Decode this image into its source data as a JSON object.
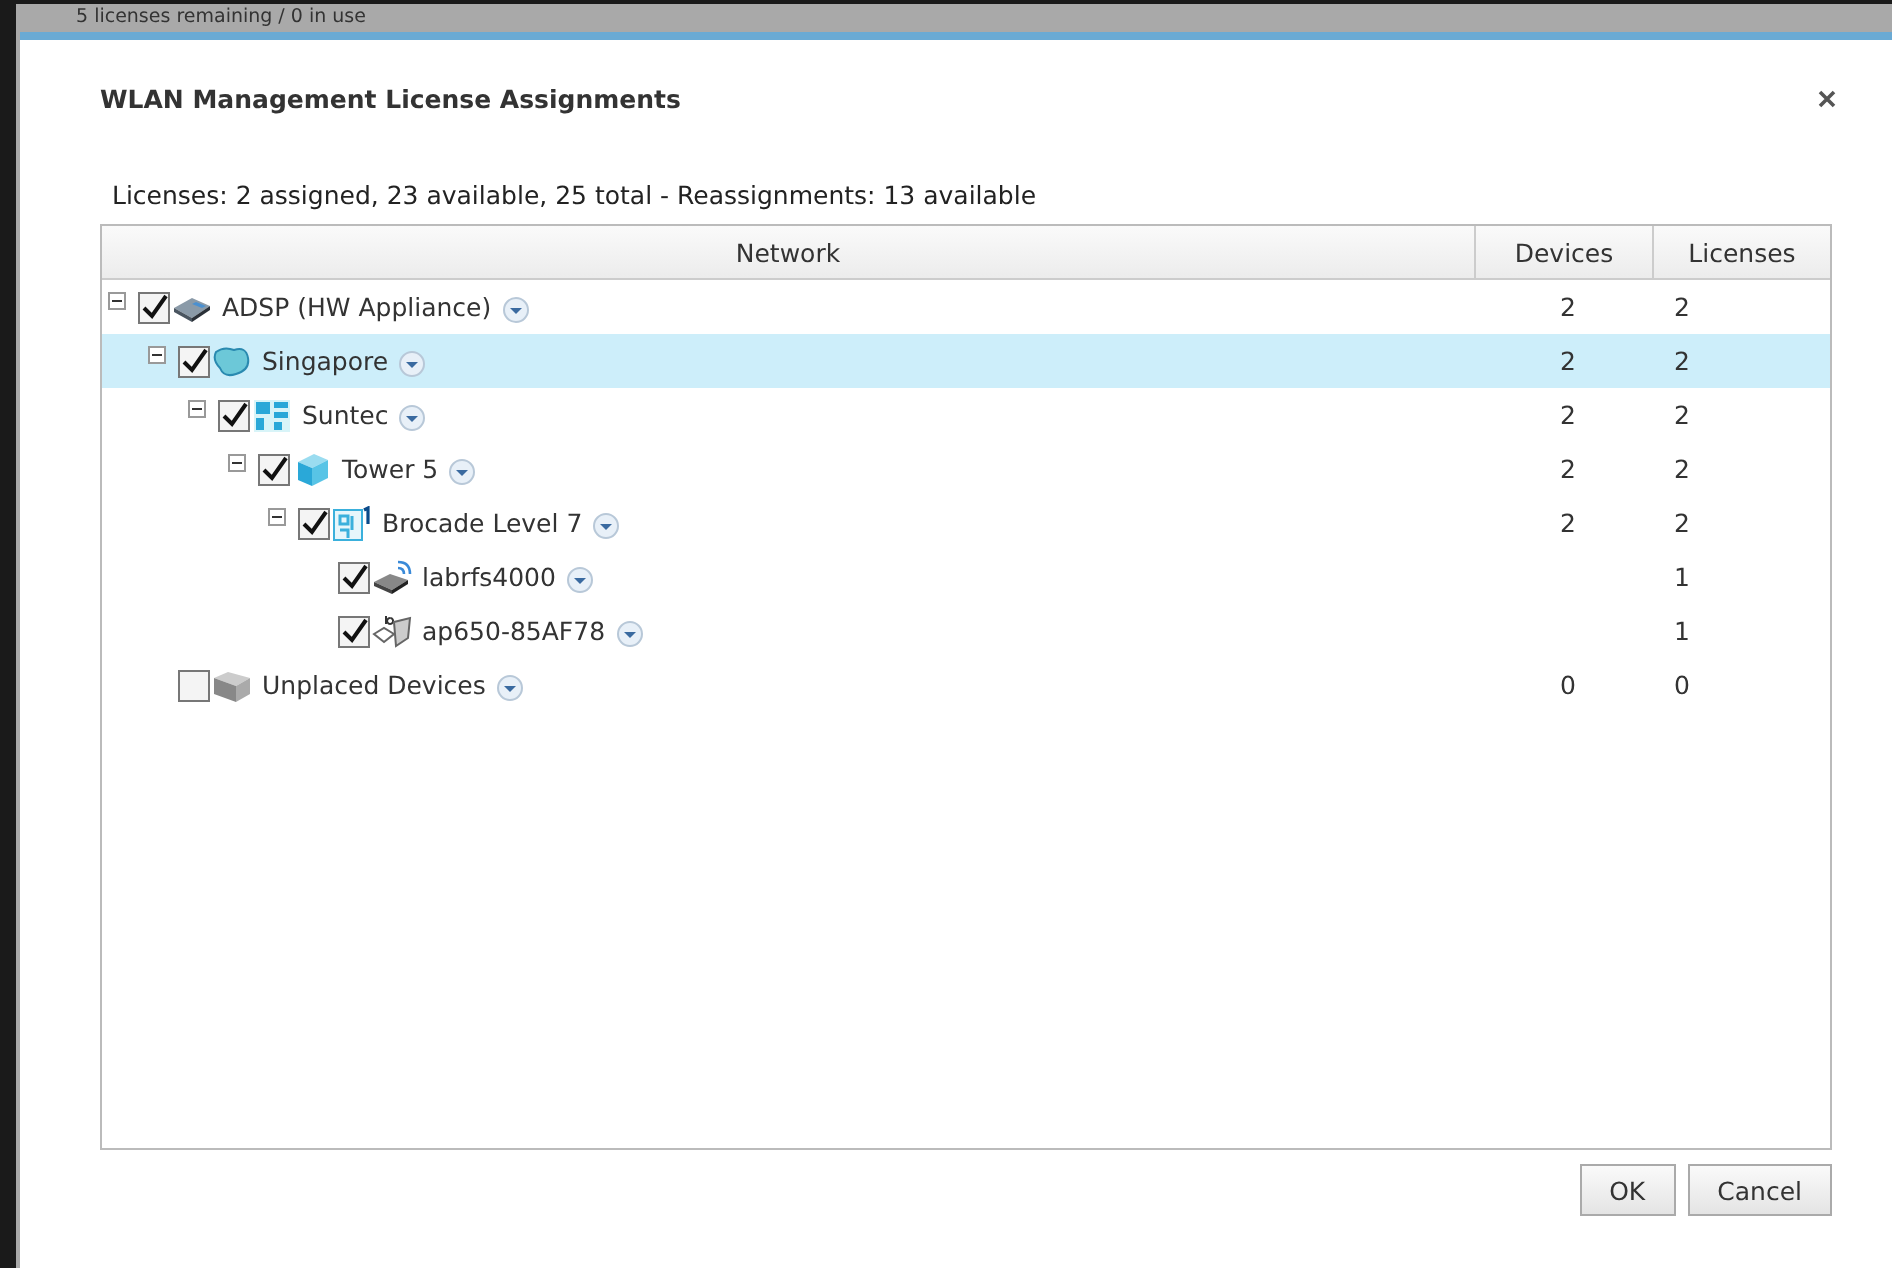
{
  "background": {
    "text": "5 licenses remaining / 0 in use"
  },
  "dialog": {
    "title": "WLAN Management License Assignments",
    "summary": "Licenses: 2 assigned, 23 available, 25 total - Reassignments: 13 available"
  },
  "table": {
    "columns": [
      "Network",
      "Devices",
      "Licenses"
    ],
    "tree": [
      {
        "label": "ADSP (HW Appliance)",
        "kind": "appliance",
        "checked": true,
        "expanded": true,
        "selected": false,
        "devices": "2",
        "licenses": "2",
        "children": [
          {
            "label": "Singapore",
            "kind": "region",
            "checked": true,
            "expanded": true,
            "selected": true,
            "devices": "2",
            "licenses": "2",
            "children": [
              {
                "label": "Suntec",
                "kind": "site",
                "checked": true,
                "expanded": true,
                "selected": false,
                "devices": "2",
                "licenses": "2",
                "children": [
                  {
                    "label": "Tower 5",
                    "kind": "building",
                    "checked": true,
                    "expanded": true,
                    "selected": false,
                    "devices": "2",
                    "licenses": "2",
                    "children": [
                      {
                        "label": "Brocade Level 7",
                        "kind": "floor",
                        "checked": true,
                        "expanded": true,
                        "selected": false,
                        "devices": "2",
                        "licenses": "2",
                        "children": [
                          {
                            "label": "labrfs4000",
                            "kind": "controller",
                            "checked": true,
                            "selected": false,
                            "licenses": "1"
                          },
                          {
                            "label": "ap650-85AF78",
                            "kind": "access-point",
                            "checked": true,
                            "selected": false,
                            "licenses": "1"
                          }
                        ]
                      }
                    ]
                  }
                ]
              }
            ]
          },
          {
            "label": "Unplaced Devices",
            "kind": "folder",
            "checked": false,
            "selected": false,
            "devices": "0",
            "licenses": "0"
          }
        ]
      }
    ]
  },
  "buttons": [
    "OK",
    "Cancel"
  ]
}
